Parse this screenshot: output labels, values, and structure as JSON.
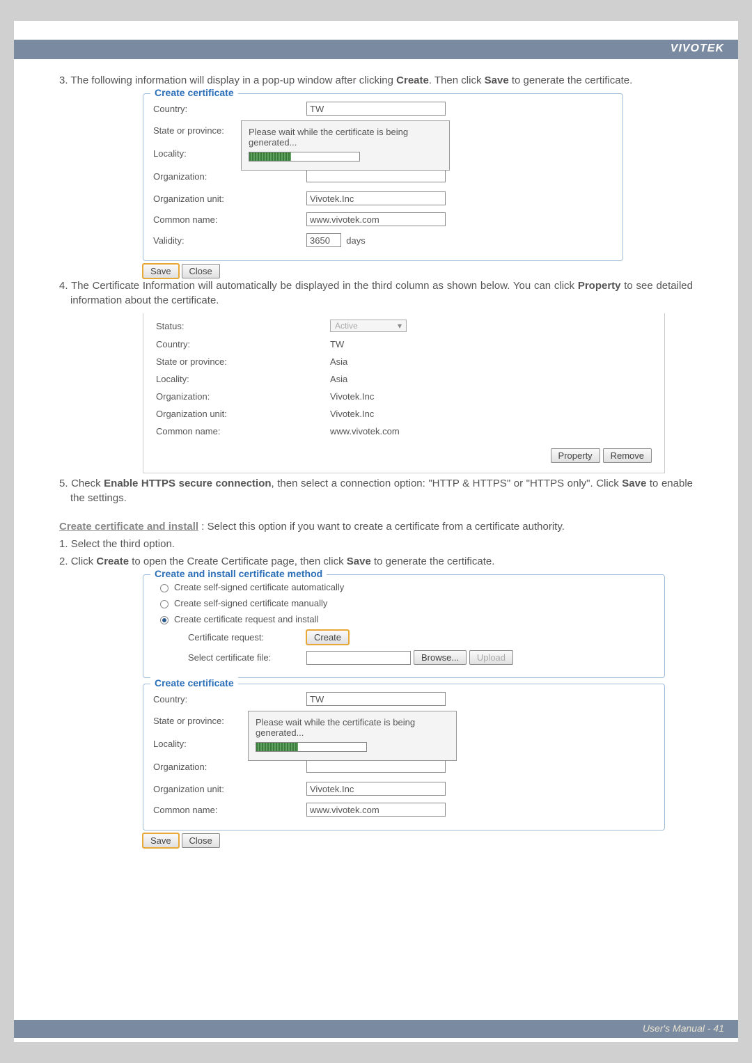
{
  "brand": "VIVOTEK",
  "step3": {
    "num": "3.",
    "text": "The following information will display in a pop-up window after clicking ",
    "b1": "Create",
    "mid": ". Then click ",
    "b2": "Save",
    "end": " to generate the certificate."
  },
  "cc1": {
    "legend": "Create certificate",
    "rows": {
      "country": {
        "label": "Country:",
        "value": "TW"
      },
      "state": {
        "label": "State or province:"
      },
      "locality": {
        "label": "Locality:"
      },
      "org": {
        "label": "Organization:"
      },
      "orgunit": {
        "label": "Organization unit:",
        "value": "Vivotek.Inc"
      },
      "common": {
        "label": "Common name:",
        "value": "www.vivotek.com"
      },
      "validity": {
        "label": "Validity:",
        "value": "3650",
        "unit": "days"
      }
    },
    "overlay": {
      "l1": "Please wait while the certificate is being",
      "l2": "generated..."
    }
  },
  "btns": {
    "save": "Save",
    "close": "Close"
  },
  "step4": {
    "num": "4.",
    "text": "The Certificate Information will automatically be displayed in the third column as shown below. You can click ",
    "b1": "Property",
    "end": " to see detailed information about the certificate."
  },
  "info": {
    "status": {
      "label": "Status:",
      "value": "Active"
    },
    "rows": [
      {
        "label": "Country:",
        "value": "TW"
      },
      {
        "label": "State or province:",
        "value": "Asia"
      },
      {
        "label": "Locality:",
        "value": "Asia"
      },
      {
        "label": "Organization:",
        "value": "Vivotek.Inc"
      },
      {
        "label": "Organization unit:",
        "value": "Vivotek.Inc"
      },
      {
        "label": "Common name:",
        "value": "www.vivotek.com"
      }
    ],
    "property": "Property",
    "remove": "Remove"
  },
  "step5": {
    "num": "5.",
    "pre": "Check ",
    "b1": "Enable HTTPS secure connection",
    "mid": ", then select a connection option: \"HTTP & HTTPS\" or \"HTTPS only\". Click ",
    "b2": "Save",
    "end": " to enable the settings."
  },
  "cci": {
    "heading": "Create certificate and install",
    "text": " :  Select this option if you want to create a certificate from a certificate authority."
  },
  "step_a": {
    "num": "1.",
    "text": "Select the third option."
  },
  "step_b": {
    "num": "2.",
    "pre": "Click ",
    "b1": "Create",
    "mid": " to open the Create Certificate page, then click ",
    "b2": "Save",
    "end": " to generate the certificate."
  },
  "methods": {
    "legend": "Create and install certificate method",
    "opt1": "Create self-signed certificate automatically",
    "opt2": "Create self-signed certificate manually",
    "opt3": "Create certificate request and install",
    "certreq": {
      "label": "Certificate request:",
      "btn": "Create"
    },
    "selfile": {
      "label": "Select certificate file:",
      "browse": "Browse...",
      "upload": "Upload"
    }
  },
  "cc2": {
    "legend": "Create certificate",
    "rows": {
      "country": {
        "label": "Country:",
        "value": "TW"
      },
      "state": {
        "label": "State or province:"
      },
      "locality": {
        "label": "Locality:"
      },
      "org": {
        "label": "Organization:"
      },
      "orgunit": {
        "label": "Organization unit:",
        "value": "Vivotek.Inc"
      },
      "common": {
        "label": "Common name:",
        "value": "www.vivotek.com"
      }
    },
    "overlay": {
      "l1": "Please wait while the certificate is being",
      "l2": "generated..."
    }
  },
  "footer": {
    "text": "User's Manual - 41"
  }
}
